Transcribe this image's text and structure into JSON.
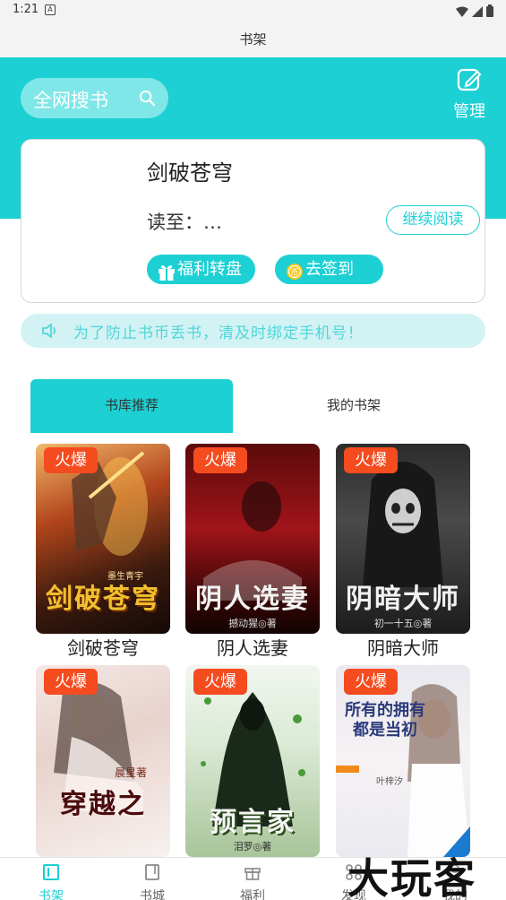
{
  "status_bar": {
    "time": "1:21",
    "notif_glyph": "A"
  },
  "titlebar": {
    "title": "书架"
  },
  "search": {
    "label": "全网搜书"
  },
  "manage": {
    "label": "管理"
  },
  "card": {
    "book_title": "剑破苍穹",
    "read_to": "读至：…",
    "continue_label": "继续阅读",
    "wheel_label": "福利转盘",
    "signin_label": "去签到"
  },
  "notice": {
    "text": "为了防止书币丢书，清及时绑定手机号！"
  },
  "tabs": [
    {
      "label": "书库推荐",
      "active": true
    },
    {
      "label": "我的书架",
      "active": false
    }
  ],
  "books": [
    {
      "name": "剑破苍穹",
      "badge": "火爆",
      "cover_text": "剑破苍穹",
      "author_line": "墨生青宇"
    },
    {
      "name": "阴人选妻",
      "badge": "火爆",
      "cover_text": "阴人选妻",
      "author_line": "撼动猩◎著"
    },
    {
      "name": "阴暗大师",
      "badge": "火爆",
      "cover_text": "阴暗大师",
      "author_line": "初一十五◎著"
    },
    {
      "name": "",
      "badge": "火爆",
      "cover_text": "穿越之",
      "author_line": "晨星著"
    },
    {
      "name": "",
      "badge": "火爆",
      "cover_text": "预言家",
      "author_line": "泪罗◎著"
    },
    {
      "name": "",
      "badge": "火爆",
      "cover_text": "所有的拥有都是当初",
      "author_line": "叶梓汐"
    }
  ],
  "bottom_nav": [
    {
      "label": "书架",
      "icon": "bookshelf-icon",
      "active": true
    },
    {
      "label": "书城",
      "icon": "book-icon",
      "active": false
    },
    {
      "label": "福利",
      "icon": "gift-icon",
      "active": false
    },
    {
      "label": "发现",
      "icon": "discover-icon",
      "active": false
    },
    {
      "label": "我的",
      "icon": "profile-icon",
      "active": false
    }
  ],
  "watermark": {
    "text": "大玩客"
  },
  "colors": {
    "accent": "#1cd0d4",
    "hot_badge": "#f44b1f",
    "notice_bg": "#d2f2f4"
  }
}
